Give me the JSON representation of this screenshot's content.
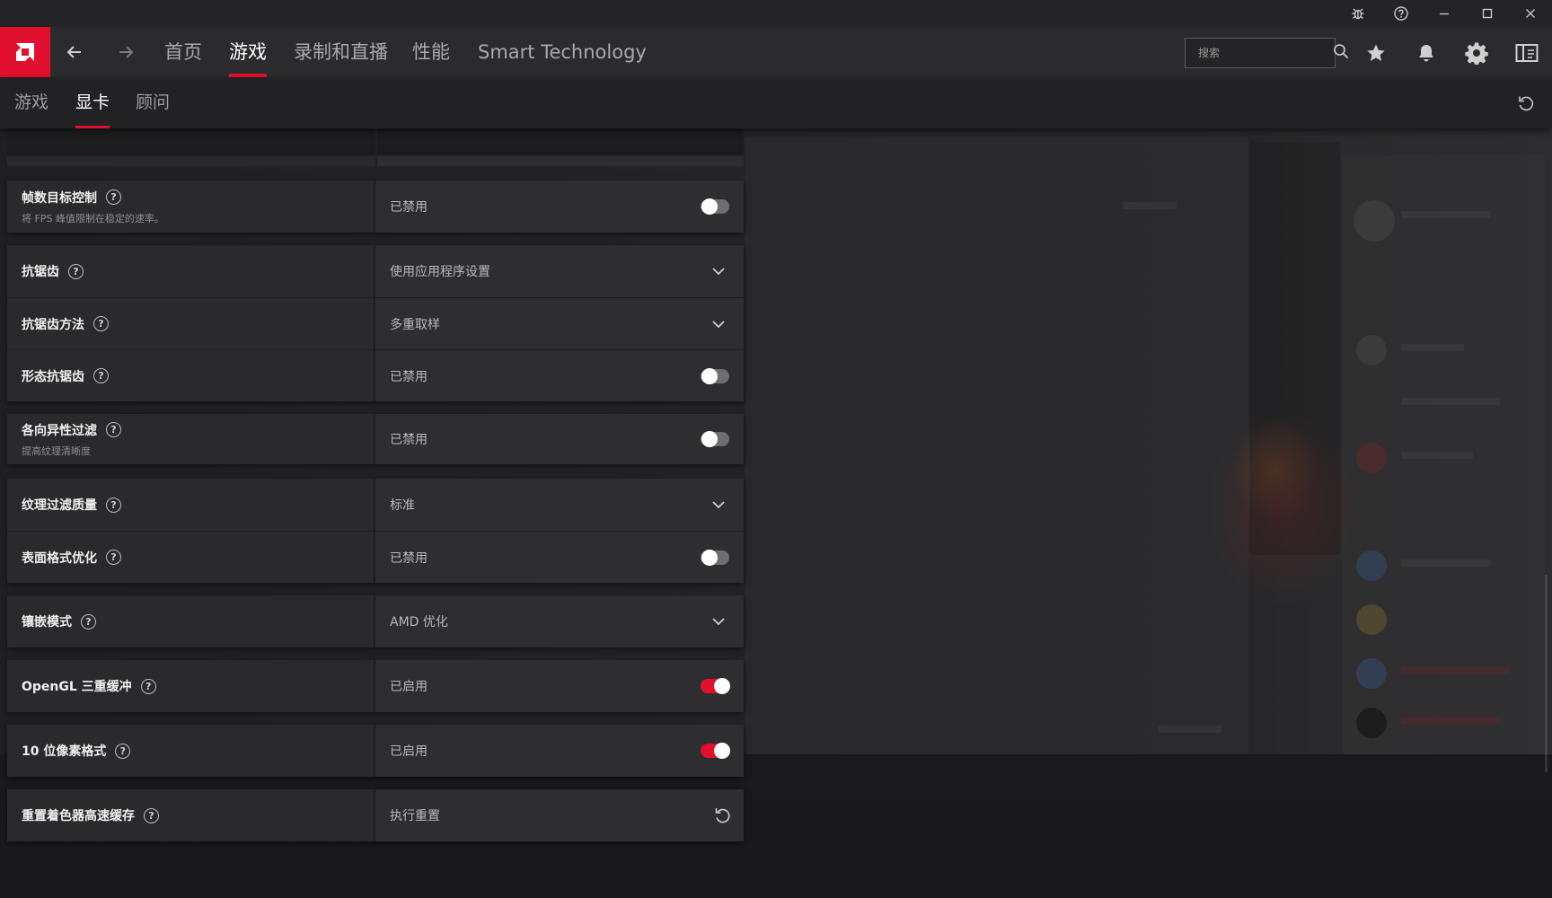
{
  "window": {
    "controls": [
      "bug-icon",
      "help-icon",
      "minimize-icon",
      "maximize-icon",
      "close-icon"
    ]
  },
  "nav": {
    "tabs": [
      {
        "label": "首页"
      },
      {
        "label": "游戏"
      },
      {
        "label": "录制和直播"
      },
      {
        "label": "性能"
      },
      {
        "label": "Smart Technology"
      }
    ],
    "active_tab": "游戏",
    "search_placeholder": "搜索"
  },
  "subtabs": {
    "tabs": [
      {
        "label": "游戏"
      },
      {
        "label": "显卡"
      },
      {
        "label": "顾问"
      }
    ],
    "active_tab": "显卡"
  },
  "settings": [
    {
      "label": "帧数目标控制",
      "desc": "将 FPS 峰值限制在稳定的速率。",
      "value": "已禁用",
      "control": "toggle",
      "on": false
    },
    {
      "label": "抗锯齿",
      "value": "使用应用程序设置",
      "control": "dropdown"
    },
    {
      "label": "抗锯齿方法",
      "value": "多重取样",
      "control": "dropdown"
    },
    {
      "label": "形态抗锯齿",
      "value": "已禁用",
      "control": "toggle",
      "on": false
    },
    {
      "label": "各向异性过滤",
      "desc": "提高纹理清晰度",
      "value": "已禁用",
      "control": "toggle",
      "on": false
    },
    {
      "label": "纹理过滤质量",
      "value": "标准",
      "control": "dropdown"
    },
    {
      "label": "表面格式优化",
      "value": "已禁用",
      "control": "toggle",
      "on": false
    },
    {
      "label": "镶嵌模式",
      "value": "AMD 优化",
      "control": "dropdown"
    },
    {
      "label": "OpenGL 三重缓冲",
      "value": "已启用",
      "control": "toggle",
      "on": true
    },
    {
      "label": "10 位像素格式",
      "value": "已启用",
      "control": "toggle",
      "on": true
    },
    {
      "label": "重置着色器高速缓存",
      "value": "执行重置",
      "control": "reset"
    }
  ],
  "colors": {
    "accent": "#e0102e",
    "toggle_off": "#6e6e70"
  }
}
